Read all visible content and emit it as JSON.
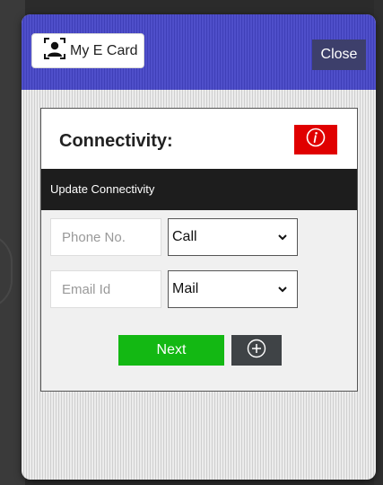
{
  "header": {
    "ecard_label": "My E Card",
    "close_label": "Close"
  },
  "card": {
    "title": "Connectivity:",
    "subheader": "Update Connectivity"
  },
  "form": {
    "phone": {
      "placeholder": "Phone No.",
      "value": ""
    },
    "phone_mode": {
      "selected": "Call"
    },
    "email": {
      "placeholder": "Email Id",
      "value": ""
    },
    "email_mode": {
      "selected": "Mail"
    }
  },
  "actions": {
    "next_label": "Next"
  },
  "colors": {
    "header": "#4545c0",
    "info_button": "#e00000",
    "next_button": "#13b813",
    "subheader": "#1d1d1d"
  },
  "icons": {
    "ecard": "contact-card-icon",
    "info": "info-icon",
    "add": "plus-circle-icon",
    "dropdown": "chevron-down-icon"
  }
}
